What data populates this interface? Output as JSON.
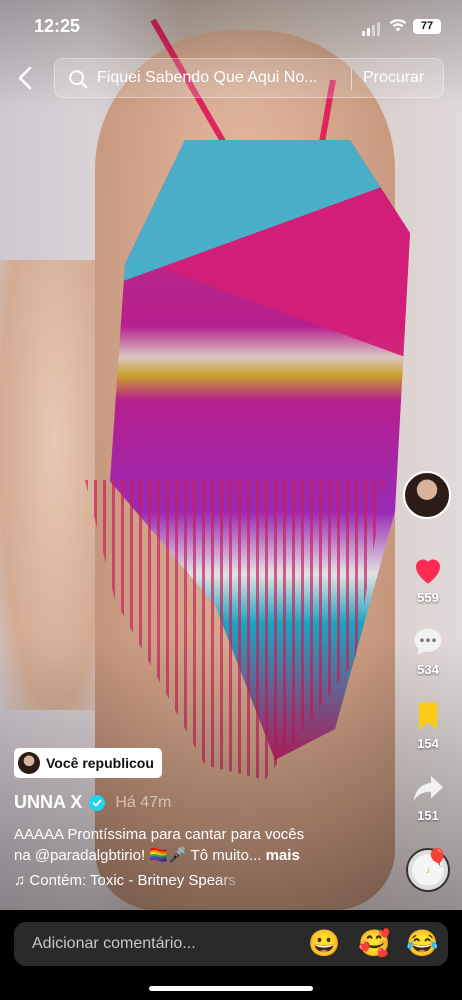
{
  "status_bar": {
    "time": "12:25",
    "battery": "77"
  },
  "header": {
    "search_text": "Fiquei Sabendo Que Aqui No...",
    "search_button": "Procurar"
  },
  "rail": {
    "likes": "559",
    "comments": "534",
    "saves": "154",
    "shares": "151"
  },
  "post": {
    "repost_label": "Você republicou",
    "author": "UNNA X",
    "time_ago": "Há 47m",
    "caption_line1": "AAAAA Prontíssima para cantar para vocês",
    "caption_line2": "na @paradalgbtirio! 🏳️‍🌈🎤 Tô muito... ",
    "caption_more": "mais",
    "music": "Contém: Toxic - Britney Spears"
  },
  "comment_bar": {
    "placeholder": "Adicionar comentário...",
    "emojis": [
      "😀",
      "🥰",
      "😂"
    ]
  },
  "colors": {
    "like": "#fe2c55",
    "save": "#facc15",
    "verified": "#20d5ec"
  }
}
